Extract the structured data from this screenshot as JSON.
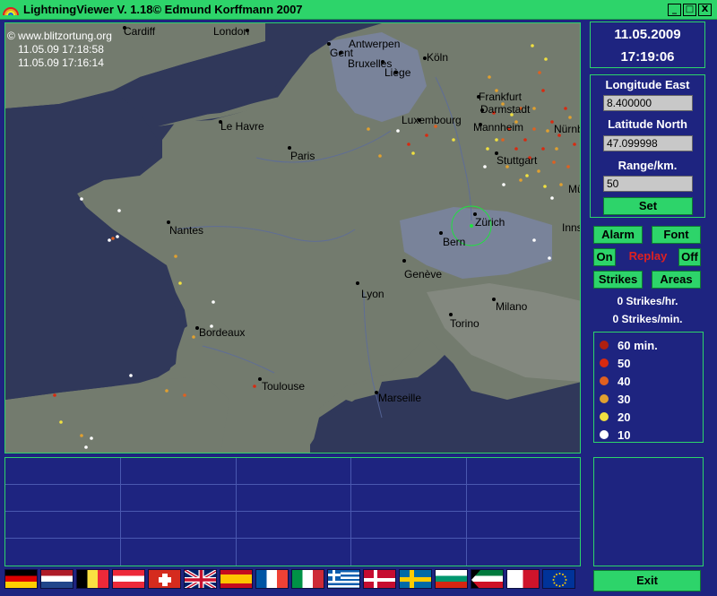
{
  "window": {
    "title": "LightningViewer V. 1.18© Edmund Korffmann 2007",
    "controls": [
      "_",
      "□",
      "X"
    ]
  },
  "map": {
    "source": "© www.blitzortung.org",
    "time1": "11.05.09 17:18:58",
    "time2": "11.05.09 17:16:14",
    "cities": {
      "cardiff": "Cardiff",
      "london": "London",
      "antwerpen": "Antwerpen",
      "gent": "Gent",
      "bruxelles": "Bruxelles",
      "koln": "Köln",
      "liege": "Liège",
      "frankfurt": "Frankfurt",
      "darmstadt": "Darmstadt",
      "mannheim": "Mannheim",
      "luxembourg": "Luxembourg",
      "lehavre": "Le Havre",
      "paris": "Paris",
      "nurnberg": "Nürnb",
      "stuttgart": "Stuttgart",
      "munchen": "Mü",
      "nantes": "Nantes",
      "zurich": "Zürich",
      "bern": "Bern",
      "innsbruck": "Inns",
      "geneve": "Genève",
      "lyon": "Lyon",
      "milano": "Milano",
      "torino": "Torino",
      "bordeaux": "Bordeaux",
      "toulouse": "Toulouse",
      "marseille": "Marseille"
    }
  },
  "datetime": {
    "date": "11.05.2009",
    "time": "17:19:06"
  },
  "controls": {
    "longitude_label": "Longitude East",
    "longitude_value": "8.400000",
    "latitude_label": "Latitude North",
    "latitude_value": "47.099998",
    "range_label": "Range/km.",
    "range_value": "50",
    "set_label": "Set"
  },
  "buttons": {
    "alarm": "Alarm",
    "font": "Font",
    "on": "On",
    "replay": "Replay",
    "off": "Off",
    "strikes": "Strikes",
    "areas": "Areas",
    "exit": "Exit"
  },
  "stats": {
    "per_hour": "0 Strikes/hr.",
    "per_minute": "0 Strikes/min."
  },
  "legend": [
    {
      "label": "60 min.",
      "color": "#b02010"
    },
    {
      "label": "50",
      "color": "#d82a10"
    },
    {
      "label": "40",
      "color": "#e06020"
    },
    {
      "label": "30",
      "color": "#e0a030"
    },
    {
      "label": "20",
      "color": "#f0e040"
    },
    {
      "label": "10",
      "color": "#ffffff"
    }
  ],
  "flags": [
    "Germany",
    "Netherlands",
    "Belgium",
    "Austria",
    "Switzerland",
    "United Kingdom",
    "Spain",
    "France",
    "Italy",
    "Greece",
    "Denmark",
    "Sweden",
    "Bulgaria",
    "Kuwait",
    "Malta",
    "European Union"
  ],
  "colors": {
    "accent": "#2dd46a",
    "background": "#1e2480",
    "sea": "#30385a",
    "land": "#737b6e",
    "replay": "#e02020"
  }
}
